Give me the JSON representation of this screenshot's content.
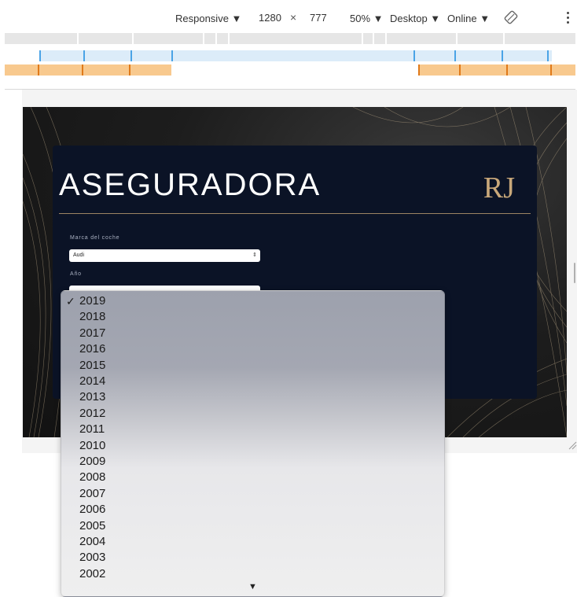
{
  "toolbar": {
    "device": "Responsive ▼",
    "width": "1280",
    "times": "×",
    "height": "777",
    "zoom": "50% ▼",
    "device_type": "Desktop ▼",
    "network": "Online ▼"
  },
  "page": {
    "title": "ASEGURADORA",
    "logo_text": "RJ",
    "brand_label": "Marca del coche",
    "brand_value": "Audi",
    "year_label": "Año"
  },
  "dropdown": {
    "selected": "2019",
    "options": [
      "2019",
      "2018",
      "2017",
      "2016",
      "2015",
      "2014",
      "2013",
      "2012",
      "2011",
      "2010",
      "2009",
      "2008",
      "2007",
      "2006",
      "2005",
      "2004",
      "2003",
      "2002"
    ],
    "check": "✓",
    "more": "▼"
  },
  "colors": {
    "card_bg": "#0b1326",
    "gold": "#c9a87a",
    "mq_blue": "#4aa3e6",
    "mq_orange": "#e07a1a"
  },
  "icons": {
    "rotate": "rotate-icon",
    "more": "more-vertical-icon",
    "logo": "brand-logo-icon",
    "resize": "resize-corner-icon"
  }
}
